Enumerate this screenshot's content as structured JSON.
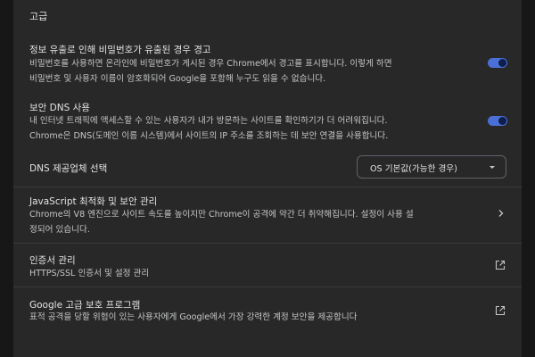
{
  "section": {
    "title": "고급"
  },
  "password_leak": {
    "title": "정보 유출로 인해 비밀번호가 유출된 경우 경고",
    "desc_line1": "비밀번호를 사용하면 온라인에 비밀번호가 게시된 경우 Chrome에서 경고를 표시합니다. 이렇게 하면",
    "desc_line2": "비밀번호 및 사용자 이름이 암호화되어 Google을 포함해 누구도 읽을 수 없습니다.",
    "toggle_on": true
  },
  "secure_dns": {
    "title": "보안 DNS 사용",
    "desc_line1": "내 인터넷 트래픽에 액세스할 수 있는 사용자가 내가 방문하는 사이트를 확인하기가 더 어려워집니다.",
    "desc_line2": "Chrome은 DNS(도메인 이름 시스템)에서 사이트의 IP 주소를 조회하는 데 보안 연결을 사용합니다.",
    "toggle_on": true
  },
  "dns_provider": {
    "label": "DNS 제공업체 선택",
    "selected": "OS 기본값(가능한 경우)"
  },
  "javascript": {
    "title": "JavaScript 최적화 및 보안 관리",
    "desc_line1": "Chrome의 V8 엔진으로 사이트 속도를 높이지만 Chrome이 공격에 약간 더 취약해집니다. 설정이 사용 설",
    "desc_line2": "정되어 있습니다."
  },
  "certificates": {
    "title": "인증서 관리",
    "desc": "HTTPS/SSL 인증서 및 설정 관리"
  },
  "advanced_protection": {
    "title": "Google 고급 보호 프로그램",
    "desc": "표적 공격을 당할 위험이 있는 사용자에게 Google에서 가장 강력한 계정 보안을 제공합니다"
  },
  "icons": {
    "chevron": "chevron-right-icon",
    "external": "open-in-new-icon",
    "dropdown": "dropdown-arrow-icon"
  },
  "colors": {
    "page_background": "#171717",
    "panel_background": "#282828",
    "toggle_track": "#4a6fd6",
    "toggle_knob": "#0d1f4a",
    "divider": "#3c3c3c"
  }
}
